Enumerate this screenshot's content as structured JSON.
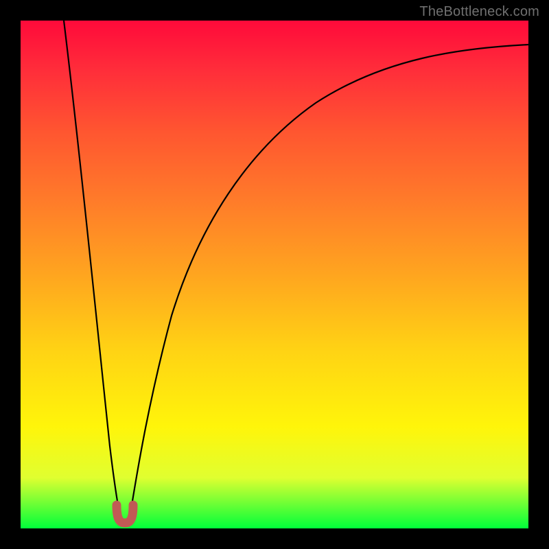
{
  "watermark": {
    "text": "TheBottleneck.com"
  },
  "colors": {
    "gradient_top": "#ff0a3a",
    "gradient_bottom": "#00ff3a",
    "curve": "#000000",
    "marker": "#c15a55",
    "frame": "#000000"
  },
  "chart_data": {
    "type": "line",
    "title": "",
    "xlabel": "",
    "ylabel": "",
    "xlim": [
      0,
      100
    ],
    "ylim": [
      0,
      100
    ],
    "grid": false,
    "legend": false,
    "background": "red-to-green vertical gradient",
    "series": [
      {
        "name": "bottleneck-curve",
        "x": [
          8,
          10,
          12,
          14,
          16,
          17,
          18,
          19,
          20,
          21,
          22,
          24,
          26,
          30,
          35,
          40,
          45,
          50,
          55,
          60,
          70,
          80,
          90,
          100
        ],
        "y": [
          100,
          82,
          64,
          46,
          27,
          17,
          8,
          2,
          0,
          2,
          8,
          20,
          30,
          45,
          58,
          67,
          73,
          78,
          82,
          85,
          89,
          92,
          94,
          95
        ]
      }
    ],
    "marker": {
      "name": "minimum-region",
      "shape": "U",
      "x_range": [
        19,
        21
      ],
      "y": 0,
      "color": "#c15a55"
    },
    "notes": "V-shaped curve rising steeply on both sides of a minimum near x≈20; right branch asymptotically rises toward top-right. Values are read off the plot proportionally (no axis ticks shown)."
  }
}
